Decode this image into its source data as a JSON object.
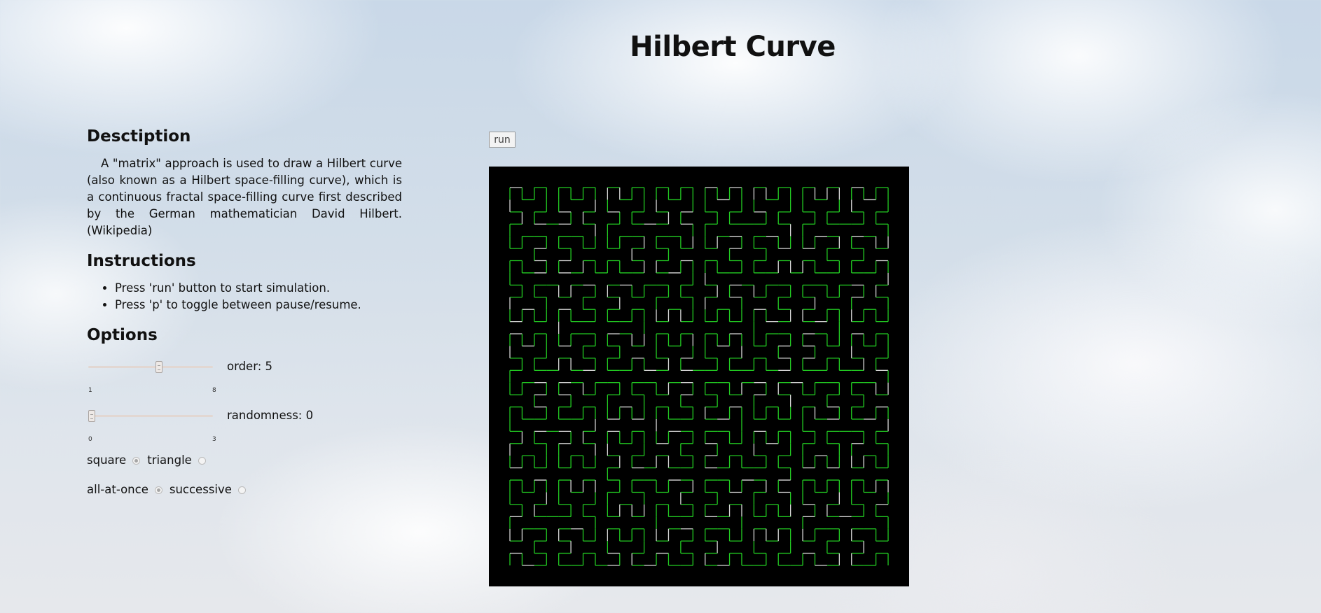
{
  "title": "Hilbert Curve",
  "description": {
    "heading": "Desctiption",
    "text": "A \"matrix\" approach is used to draw a Hilbert curve (also known as a Hilbert space-filling curve), which is a continuous fractal space-filling curve first described by the German mathematician David Hilbert. (Wikipedia)"
  },
  "instructions": {
    "heading": "Instructions",
    "items": [
      "Press 'run' button to start simulation.",
      "Press 'p' to toggle between pause/resume."
    ]
  },
  "options": {
    "heading": "Options",
    "order": {
      "label": "order: 5",
      "min": "1",
      "max": "8",
      "min_value": 1,
      "max_value": 8,
      "value": 5
    },
    "randomness": {
      "label": "randomness: 0",
      "min": "0",
      "max": "3",
      "min_value": 0,
      "max_value": 3,
      "value": 0
    },
    "shape": {
      "square_label": "square",
      "triangle_label": "triangle",
      "selected": "square"
    },
    "mode": {
      "all_at_once_label": "all-at-once",
      "successive_label": "successive",
      "selected": "all-at-once"
    }
  },
  "run_button_label": "run",
  "canvas": {
    "background_color": "#000000",
    "curve_color": "#22cc22",
    "curve_highlight_color": "#d8d8d8",
    "curve_order": 5
  }
}
